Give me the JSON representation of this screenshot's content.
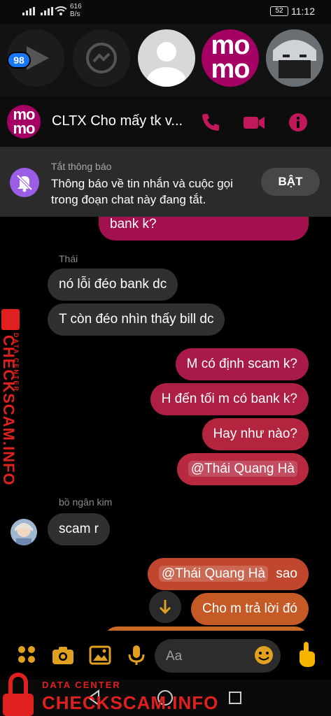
{
  "status_bar": {
    "network_speed_value": "616",
    "network_speed_unit": "B/s",
    "battery": "52",
    "time": "11:12"
  },
  "chat_heads": {
    "badge_count": "98",
    "momo_logo_line1": "mo",
    "momo_logo_line2": "mo"
  },
  "header": {
    "title": "CLTX Cho mấy tk v...",
    "avatar_line1": "mo",
    "avatar_line2": "mo"
  },
  "mute_notice": {
    "label": "Tắt thông báo",
    "description": "Thông báo về tin nhắn và cuộc gọi trong đoạn chat này đang tắt.",
    "button": "BẬT"
  },
  "messages": {
    "m0": "bank k?",
    "sender_thai": "Thái",
    "m1": "nó lỗi đéo bank dc",
    "m2": "T còn đéo nhìn thấy bill dc",
    "m3": "M có định scam k?",
    "m4": "H đến tối m có bank k?",
    "m5": "Hay như nào?",
    "m6_mention": "@Thái Quang Hà",
    "sender_kim": "bồ ngân kim",
    "m7": "scam r",
    "m8_mention": "@Thái Quang Hà",
    "m8_text": "sao",
    "m9": "Cho m trả lời đó"
  },
  "composer": {
    "placeholder": "Aa"
  },
  "watermark": {
    "line1": "DATA CENTER",
    "line2": "CHECKSCAM.INFO"
  },
  "colors": {
    "bubble_magenta": "#a3104f",
    "bubble_red": "#b8283f",
    "bubble_orange": "#c55a27",
    "accent": "#c2185b",
    "watermark_red": "#e0201e"
  }
}
